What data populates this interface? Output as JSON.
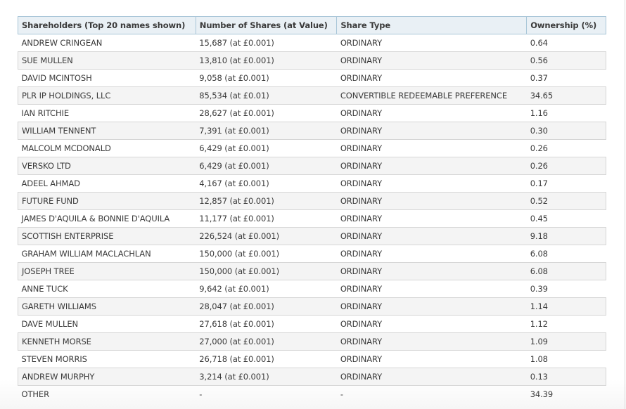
{
  "table": {
    "headers": [
      "Shareholders (Top 20 names shown)",
      "Number of Shares (at Value)",
      "Share Type",
      "Ownership (%)"
    ],
    "rows": [
      [
        "ANDREW CRINGEAN",
        "15,687 (at £0.001)",
        "ORDINARY",
        "0.64"
      ],
      [
        "SUE MULLEN",
        "13,810 (at £0.001)",
        "ORDINARY",
        "0.56"
      ],
      [
        "DAVID MCINTOSH",
        "9,058 (at £0.001)",
        "ORDINARY",
        "0.37"
      ],
      [
        "PLR IP HOLDINGS, LLC",
        "85,534 (at £0.01)",
        "CONVERTIBLE REDEEMABLE PREFERENCE",
        "34.65"
      ],
      [
        "IAN RITCHIE",
        "28,627 (at £0.001)",
        "ORDINARY",
        "1.16"
      ],
      [
        "WILLIAM TENNENT",
        "7,391 (at £0.001)",
        "ORDINARY",
        "0.30"
      ],
      [
        "MALCOLM MCDONALD",
        "6,429 (at £0.001)",
        "ORDINARY",
        "0.26"
      ],
      [
        "VERSKO LTD",
        "6,429 (at £0.001)",
        "ORDINARY",
        "0.26"
      ],
      [
        "ADEEL AHMAD",
        "4,167 (at £0.001)",
        "ORDINARY",
        "0.17"
      ],
      [
        "FUTURE FUND",
        "12,857 (at £0.001)",
        "ORDINARY",
        "0.52"
      ],
      [
        "JAMES D'AQUILA & BONNIE D'AQUILA",
        "11,177 (at £0.001)",
        "ORDINARY",
        "0.45"
      ],
      [
        "SCOTTISH ENTERPRISE",
        "226,524 (at £0.001)",
        "ORDINARY",
        "9.18"
      ],
      [
        "GRAHAM WILLIAM MACLACHLAN",
        "150,000 (at £0.001)",
        "ORDINARY",
        "6.08"
      ],
      [
        "JOSEPH TREE",
        "150,000 (at £0.001)",
        "ORDINARY",
        "6.08"
      ],
      [
        "ANNE TUCK",
        "9,642 (at £0.001)",
        "ORDINARY",
        "0.39"
      ],
      [
        "GARETH WILLIAMS",
        "28,047 (at £0.001)",
        "ORDINARY",
        "1.14"
      ],
      [
        "DAVE MULLEN",
        "27,618 (at £0.001)",
        "ORDINARY",
        "1.12"
      ],
      [
        "KENNETH MORSE",
        "27,000 (at £0.001)",
        "ORDINARY",
        "1.09"
      ],
      [
        "STEVEN MORRIS",
        "26,718 (at £0.001)",
        "ORDINARY",
        "1.08"
      ],
      [
        "ANDREW MURPHY",
        "3,214 (at £0.001)",
        "ORDINARY",
        "0.13"
      ],
      [
        "OTHER",
        "-",
        "-",
        "34.39"
      ]
    ]
  }
}
